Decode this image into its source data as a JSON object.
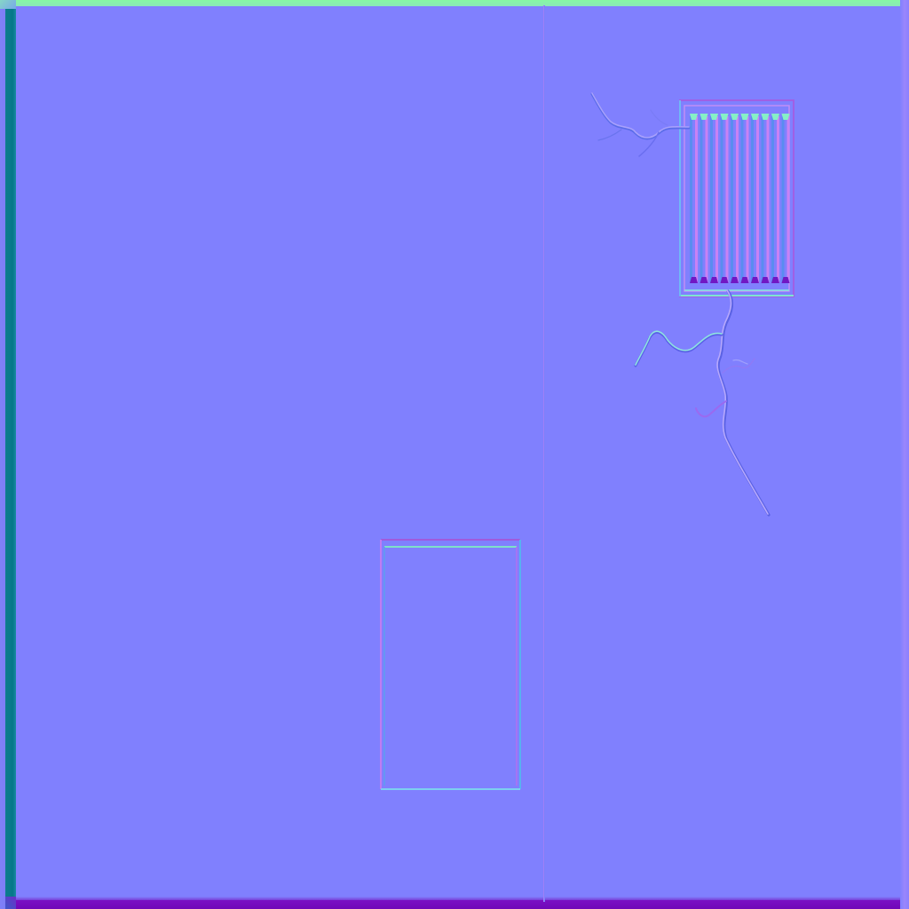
{
  "texture": {
    "base_color": "#8080fe",
    "edges": {
      "top_color": "#86f7a4",
      "left_color": "#0c7c8e",
      "bottom_color": "#7a10c4",
      "divider_color": "#9a80f8"
    },
    "features": {
      "door_outline": {
        "count": 1
      },
      "vent_grille": {
        "slat_count": 10
      },
      "cracks": {
        "count": 2
      }
    }
  }
}
